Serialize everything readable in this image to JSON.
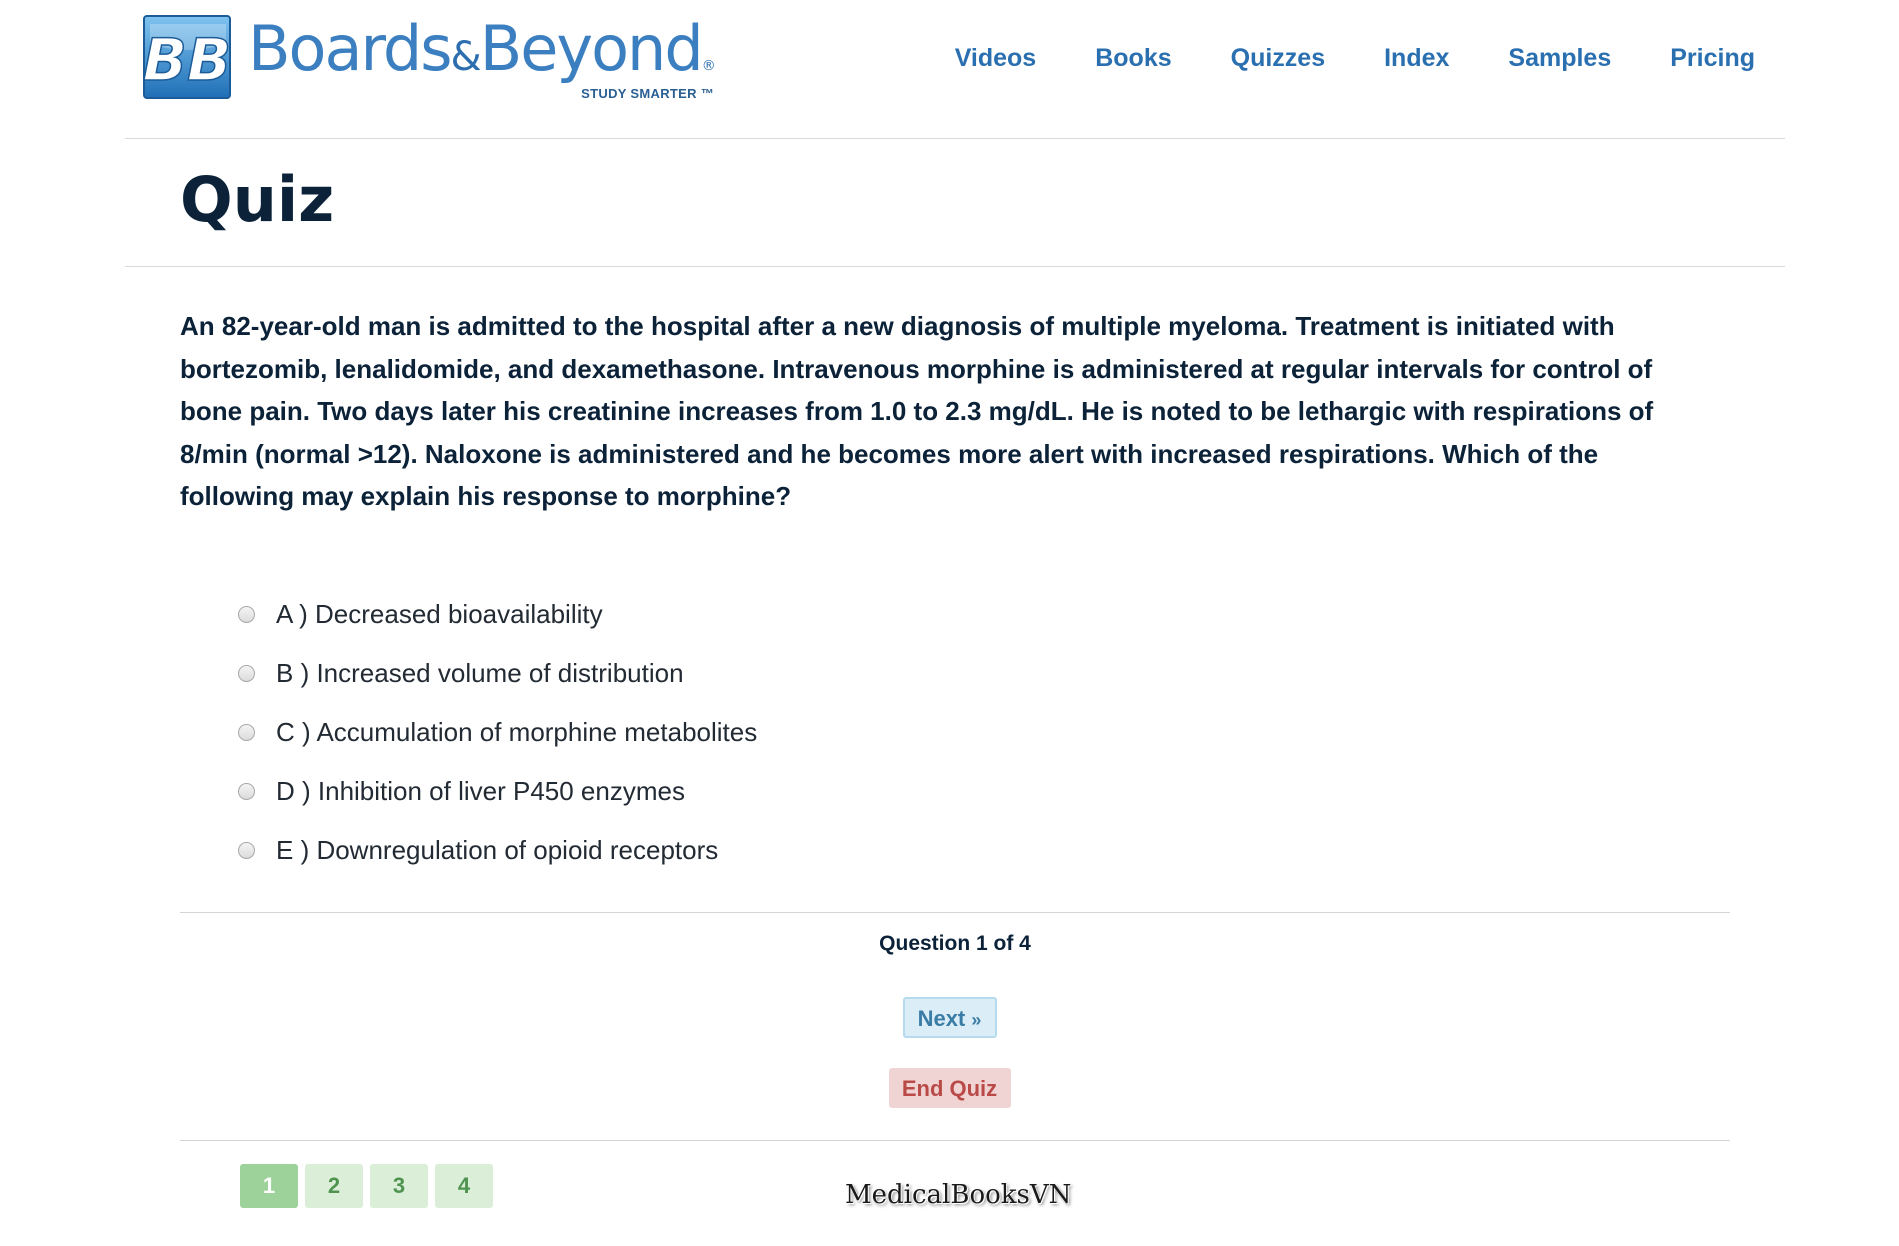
{
  "brand": {
    "mark": "BB",
    "name_part1": "Boards",
    "name_amp": "&",
    "name_part2": "Beyond",
    "registered": "®",
    "tagline": "STUDY SMARTER ™"
  },
  "nav": {
    "items": [
      "Videos",
      "Books",
      "Quizzes",
      "Index",
      "Samples",
      "Pricing"
    ]
  },
  "page": {
    "title": "Quiz"
  },
  "question": {
    "text": "An 82-year-old man is admitted to the hospital after a new diagnosis of multiple myeloma. Treatment is initiated with bortezomib, lenalidomide, and dexamethasone. Intravenous morphine is administered at regular intervals for control of bone pain. Two days later his creatinine increases from 1.0 to 2.3 mg/dL. He is noted to be lethargic with respirations of 8/min (normal >12). Naloxone is administered and he becomes more alert with increased respirations. Which of the following may explain his response to morphine?",
    "options": [
      "A ) Decreased bioavailability",
      "B ) Increased volume of distribution",
      "C ) Accumulation of morphine metabolites",
      "D ) Inhibition of liver P450 enzymes",
      "E ) Downregulation of opioid receptors"
    ]
  },
  "controls": {
    "progress": "Question 1 of 4",
    "next_label": "Next",
    "next_arrow": "»",
    "end_label": "End Quiz"
  },
  "pager": {
    "pages": [
      "1",
      "2",
      "3",
      "4"
    ],
    "active": "1"
  },
  "watermark": "MedicalBooksVN",
  "colors": {
    "brand_blue": "#3b7fc0",
    "nav_blue": "#2a6fb0",
    "heading_navy": "#0b2238",
    "next_bg": "#dbeef8",
    "end_bg": "#f0d4d4",
    "end_text": "#b94a48",
    "page_active": "#9dd39b",
    "page_inactive": "#dbeed8"
  }
}
